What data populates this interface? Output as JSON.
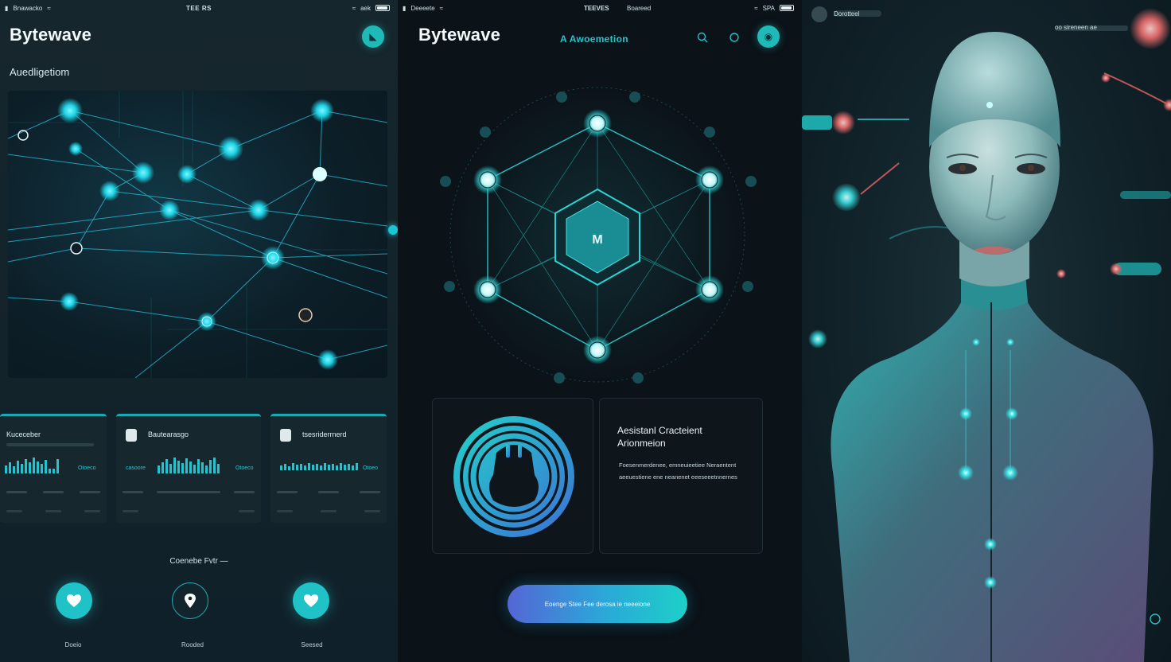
{
  "panel1": {
    "status": {
      "left": "Bnawacko",
      "center": "TEE RS",
      "right": "aek"
    },
    "brand": "Bytewave",
    "section_title": "Auedligetiom",
    "cards": [
      {
        "title": "Kuceceber",
        "label": "Otoeco"
      },
      {
        "title": "Bautearasgo",
        "label_left": "casoore",
        "label": "Otoeco"
      },
      {
        "title": "tsesriderrnerd",
        "label": "Otoeo"
      }
    ],
    "connect_label": "Coenebe Fvtr  —",
    "connect_buttons": [
      {
        "label": "Doeio",
        "icon": "heart-icon"
      },
      {
        "label": "Rooded",
        "icon": "location-pin-icon"
      },
      {
        "label": "Seesed",
        "icon": "heart-icon"
      }
    ]
  },
  "panel2": {
    "status": {
      "left": "Deeeete",
      "center": "TEEVES",
      "center2": "Boareed",
      "right": "SPA"
    },
    "brand": "Bytewave",
    "subtitle": "A Awoemetion",
    "feature": {
      "title": "Aesistanl Cracteient Arionmeion",
      "body": "Foesenmerdenee, emneuieetiee Neraentent aeeuestiene ene neanenet eeeseeetnnernes"
    },
    "cta_label": "Eoenge Stee Fee derosa ie neeeione"
  },
  "panel3": {
    "tag_left": "Dorotteel",
    "tag_right": "oo sireneen ae"
  },
  "colors": {
    "accent": "#1fc3c7",
    "bg": "#0b1218",
    "alert": "#f06e6e"
  }
}
